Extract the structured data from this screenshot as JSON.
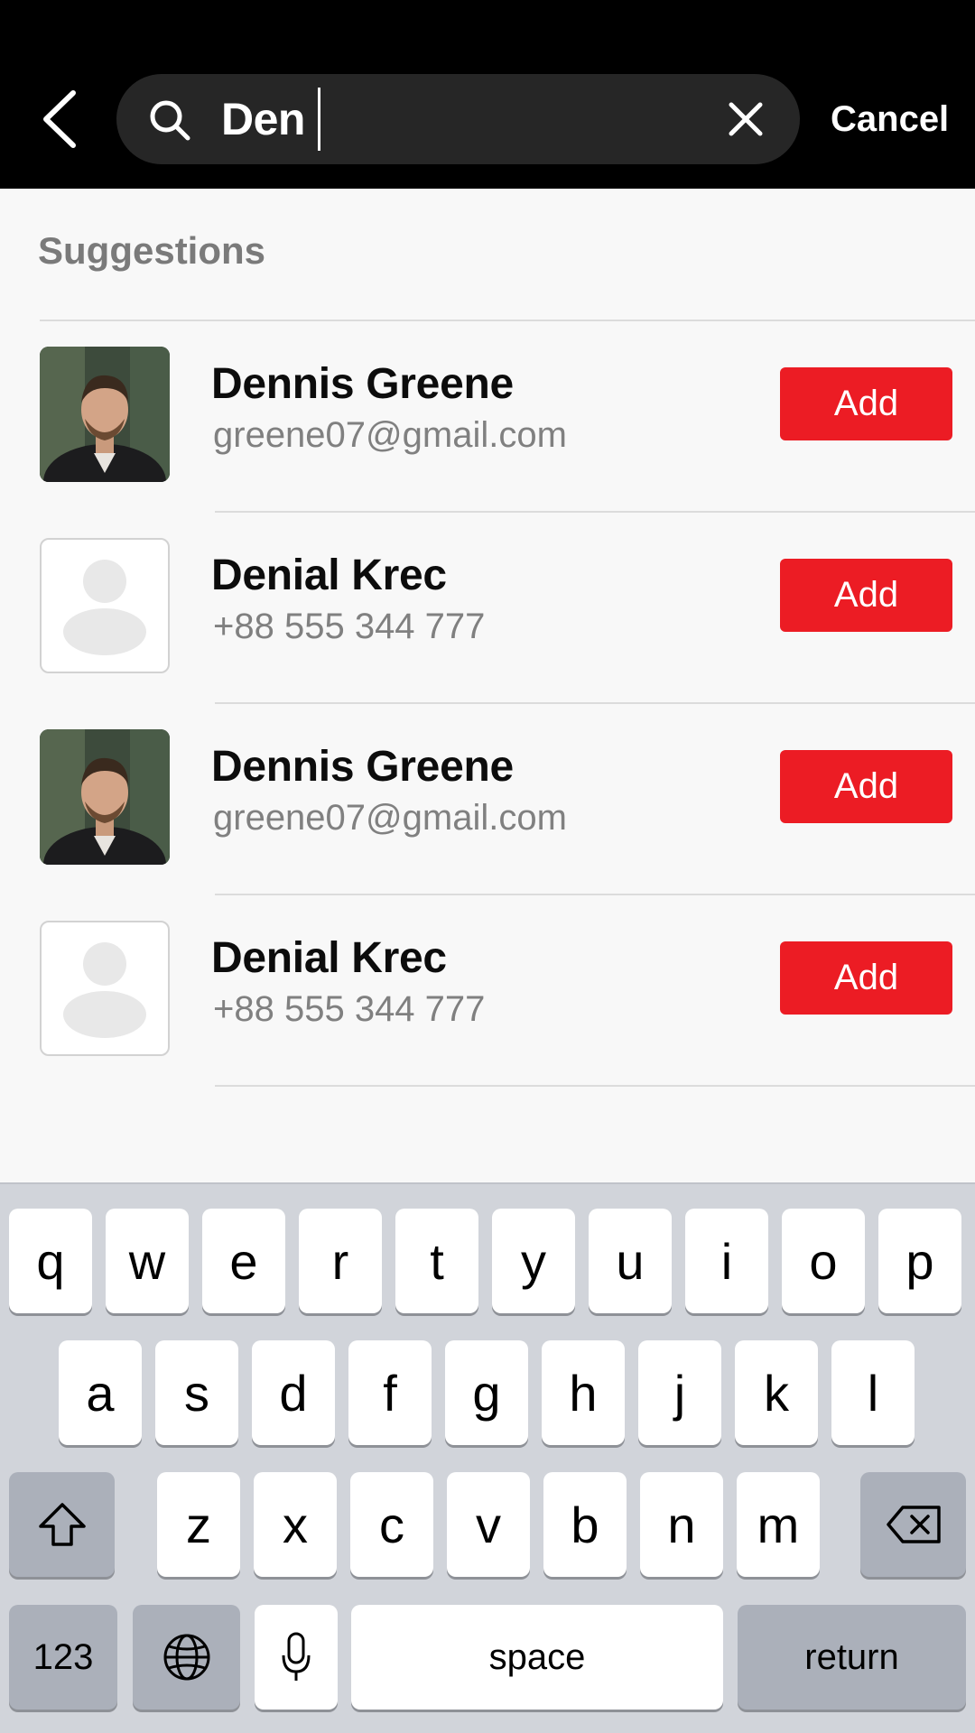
{
  "search": {
    "value": "Den",
    "cancel_label": "Cancel"
  },
  "suggestions": {
    "title": "Suggestions",
    "items": [
      {
        "name": "Dennis Greene",
        "detail": "greene07@gmail.com",
        "avatar": "photo",
        "button": "Add"
      },
      {
        "name": "Denial Krec",
        "detail": "+88 555 344 777",
        "avatar": "placeholder",
        "button": "Add"
      },
      {
        "name": "Dennis Greene",
        "detail": "greene07@gmail.com",
        "avatar": "photo",
        "button": "Add"
      },
      {
        "name": "Denial Krec",
        "detail": "+88 555 344 777",
        "avatar": "placeholder",
        "button": "Add"
      }
    ]
  },
  "keyboard": {
    "row1": [
      "q",
      "w",
      "e",
      "r",
      "t",
      "y",
      "u",
      "i",
      "o",
      "p"
    ],
    "row2": [
      "a",
      "s",
      "d",
      "f",
      "g",
      "h",
      "j",
      "k",
      "l"
    ],
    "row3": [
      "z",
      "x",
      "c",
      "v",
      "b",
      "n",
      "m"
    ],
    "numbers_label": "123",
    "space_label": "space",
    "return_label": "return"
  },
  "icons": {
    "back": "chevron-left-icon",
    "search": "search-icon",
    "clear": "close-icon",
    "shift": "shift-icon",
    "delete": "backspace-icon",
    "globe": "globe-icon",
    "mic": "microphone-icon"
  },
  "colors": {
    "accent": "#ec1c24",
    "topbar": "#000000",
    "search_field": "#262626"
  }
}
